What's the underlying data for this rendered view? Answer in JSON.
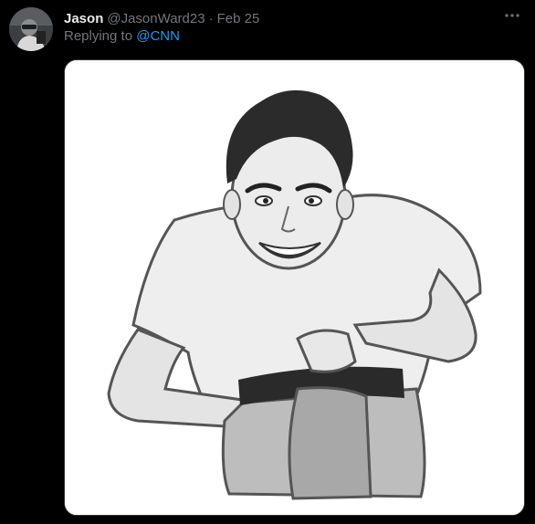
{
  "tweet": {
    "author": {
      "display_name": "Jason",
      "handle": "@JasonWard23"
    },
    "separator": "·",
    "timestamp": "Feb 25",
    "replying_prefix": "Replying to ",
    "replying_to": "@CNN",
    "more_icon": "more-horizontal-icon"
  },
  "colors": {
    "background": "#000000",
    "primary_text": "#e7e9ea",
    "secondary_text": "#71767b",
    "accent": "#1d9bf0"
  }
}
